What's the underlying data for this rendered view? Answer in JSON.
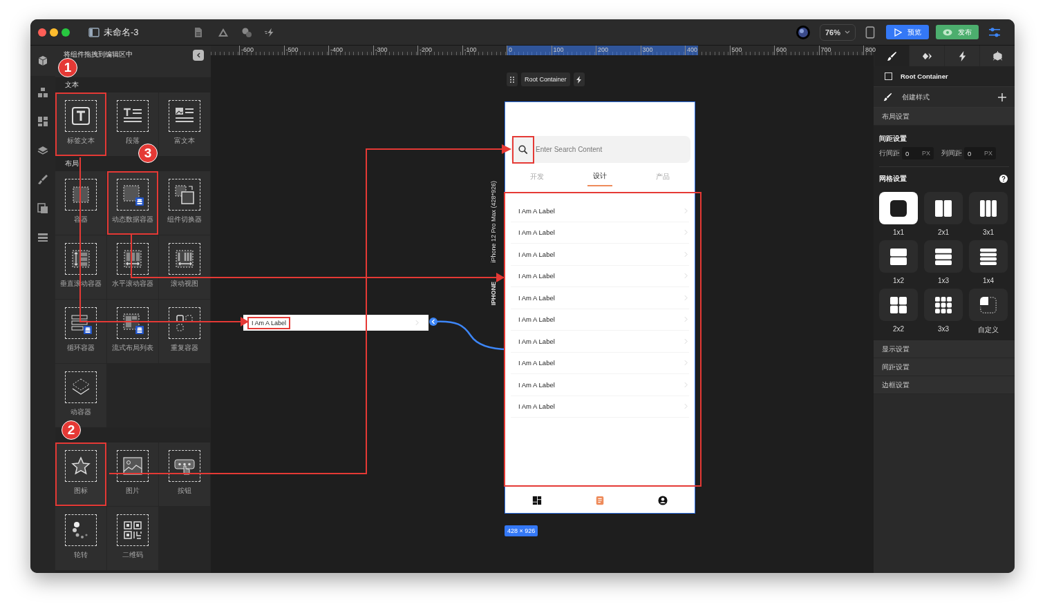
{
  "window": {
    "title": "未命名-3"
  },
  "toolbar": {
    "zoom": "76%",
    "preview": "预览",
    "publish": "发布"
  },
  "ruler": {
    "ticks": [
      "-600",
      "-500",
      "-400",
      "-300",
      "-200",
      "-100",
      "0",
      "100",
      "200",
      "300",
      "400",
      "500",
      "600",
      "700",
      "800"
    ]
  },
  "component_panel": {
    "hint": "将组件拖拽到编辑区中",
    "sections": [
      {
        "title": "文本",
        "items": [
          {
            "label": "标签文本",
            "kind": "text",
            "highlighted": true
          },
          {
            "label": "段落",
            "kind": "paragraph",
            "highlighted": false
          },
          {
            "label": "富文本",
            "kind": "richtext",
            "highlighted": false
          }
        ]
      },
      {
        "title": "布局",
        "items": [
          {
            "label": "容器",
            "kind": "container",
            "highlighted": false
          },
          {
            "label": "动态数据容器",
            "kind": "dynamic",
            "highlighted": true
          },
          {
            "label": "组件切换器",
            "kind": "switcher",
            "highlighted": false
          },
          {
            "label": "垂直滚动容器",
            "kind": "vscroll",
            "highlighted": false
          },
          {
            "label": "水平滚动容器",
            "kind": "hscroll",
            "highlighted": false
          },
          {
            "label": "滚动视图",
            "kind": "scrollview",
            "highlighted": false
          },
          {
            "label": "循环容器",
            "kind": "loop",
            "highlighted": false
          },
          {
            "label": "流式布局列表",
            "kind": "flow",
            "highlighted": false
          },
          {
            "label": "重复容器",
            "kind": "repeat",
            "highlighted": false
          },
          {
            "label": "动容器",
            "kind": "layers",
            "highlighted": false
          }
        ]
      },
      {
        "items": [
          {
            "label": "图标",
            "kind": "star",
            "highlighted": true
          },
          {
            "label": "图片",
            "kind": "image",
            "highlighted": false
          },
          {
            "label": "按钮",
            "kind": "button",
            "highlighted": false
          },
          {
            "label": "轮转",
            "kind": "carousel",
            "highlighted": false
          },
          {
            "label": "二维码",
            "kind": "qrcode",
            "highlighted": false
          }
        ]
      }
    ]
  },
  "canvas": {
    "root_label": "Root Container",
    "dragged_item": {
      "label": "I Am A Label",
      "highlighted": true
    },
    "device_name": "iPhone 12 Pro Max (428*926)",
    "device_type": "IPHONE",
    "size": "428 × 926",
    "phone": {
      "search": {
        "placeholder": "Enter Search Content",
        "highlighted": true
      },
      "tabs": [
        {
          "label": "开发",
          "selected": false
        },
        {
          "label": "设计",
          "selected": true
        },
        {
          "label": "产品",
          "selected": false
        }
      ],
      "list_highlighted": true,
      "rows": [
        "I Am A Label",
        "I Am A Label",
        "I Am A Label",
        "I Am A Label",
        "I Am A Label",
        "I Am A Label",
        "I Am A Label",
        "I Am A Label",
        "I Am A Label",
        "I Am A Label"
      ],
      "nav": [
        {
          "kind": "grid",
          "selected": false
        },
        {
          "kind": "doc",
          "selected": true
        },
        {
          "kind": "user",
          "selected": false
        }
      ]
    }
  },
  "callouts": [
    "1",
    "2",
    "3"
  ],
  "inspector": {
    "tabs": [
      {
        "kind": "brush",
        "selected": true
      },
      {
        "kind": "diamond",
        "selected": false
      },
      {
        "kind": "bolt",
        "selected": false
      },
      {
        "kind": "box",
        "selected": false
      }
    ],
    "root": {
      "label": "Root Container",
      "checked": false
    },
    "style_row": "创建样式",
    "layout_header": "布局设置",
    "spacing": {
      "title": "间距设置",
      "fields": [
        {
          "label": "行间距",
          "value": "0",
          "unit": "PX"
        },
        {
          "label": "列间距",
          "value": "0",
          "unit": "PX"
        }
      ]
    },
    "grid": {
      "title": "网格设置",
      "options": [
        {
          "label": "1x1",
          "kind": "single",
          "selected": true
        },
        {
          "label": "2x1",
          "kind": "twocol",
          "selected": false
        },
        {
          "label": "3x1",
          "kind": "threecol",
          "selected": false
        },
        {
          "label": "1x2",
          "kind": "tworow",
          "selected": false
        },
        {
          "label": "1x3",
          "kind": "threerow",
          "selected": false
        },
        {
          "label": "1x4",
          "kind": "fourrow",
          "selected": false
        },
        {
          "label": "2x2",
          "kind": "quad",
          "selected": false
        },
        {
          "label": "3x3",
          "kind": "nine",
          "selected": false
        },
        {
          "label": "自定义",
          "kind": "custom",
          "selected": false
        }
      ]
    },
    "collapsed": [
      "显示设置",
      "间距设置",
      "边框设置"
    ]
  }
}
